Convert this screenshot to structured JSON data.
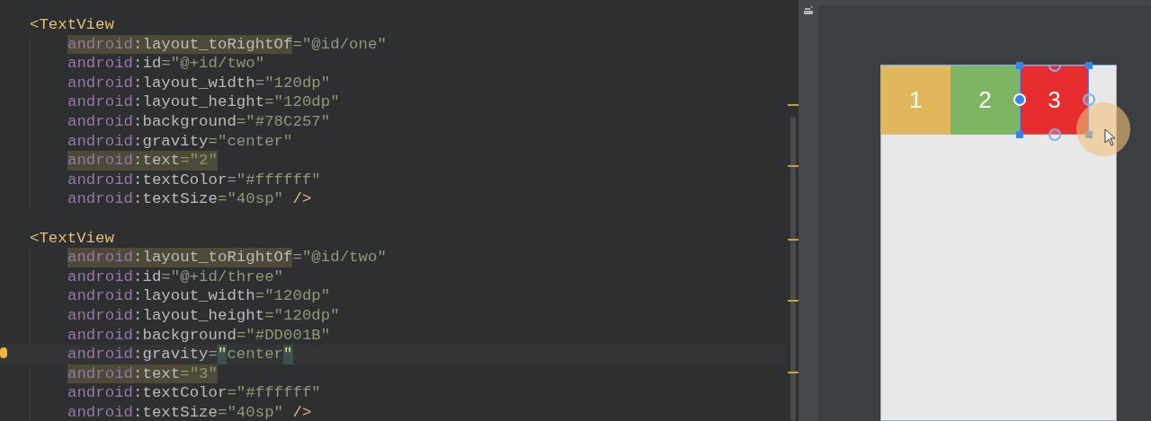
{
  "editor": {
    "lines": [
      {
        "kind": "tag",
        "current": false,
        "segments": [
          {
            "kind": "plain",
            "tokens": [
              {
                "kind": "tag",
                "text": "<TextView"
              }
            ]
          }
        ]
      },
      {
        "kind": "attribute",
        "current": false,
        "segments": [
          {
            "kind": "usage",
            "tokens": [
              {
                "kind": "ns",
                "text": "android"
              },
              {
                "kind": "attr",
                "text": ":layout_toRightOf"
              }
            ]
          },
          {
            "kind": "plain",
            "tokens": [
              {
                "kind": "value",
                "text": "=\"@id/one\""
              }
            ]
          }
        ]
      },
      {
        "kind": "attribute",
        "current": false,
        "segments": [
          {
            "kind": "plain",
            "tokens": [
              {
                "kind": "ns",
                "text": "android"
              },
              {
                "kind": "attr",
                "text": ":id"
              },
              {
                "kind": "value",
                "text": "=\"@+id/two\""
              }
            ]
          }
        ]
      },
      {
        "kind": "attribute",
        "current": false,
        "segments": [
          {
            "kind": "plain",
            "tokens": [
              {
                "kind": "ns",
                "text": "android"
              },
              {
                "kind": "attr",
                "text": ":layout_width"
              },
              {
                "kind": "value",
                "text": "=\"120dp\""
              }
            ]
          }
        ]
      },
      {
        "kind": "attribute",
        "current": false,
        "segments": [
          {
            "kind": "plain",
            "tokens": [
              {
                "kind": "ns",
                "text": "android"
              },
              {
                "kind": "attr",
                "text": ":layout_height"
              },
              {
                "kind": "value",
                "text": "=\"120dp\""
              }
            ]
          }
        ]
      },
      {
        "kind": "attribute",
        "current": false,
        "segments": [
          {
            "kind": "plain",
            "tokens": [
              {
                "kind": "ns",
                "text": "android"
              },
              {
                "kind": "attr",
                "text": ":background"
              },
              {
                "kind": "value",
                "text": "=\"#78C257\""
              }
            ]
          }
        ]
      },
      {
        "kind": "attribute",
        "current": false,
        "segments": [
          {
            "kind": "plain",
            "tokens": [
              {
                "kind": "ns",
                "text": "android"
              },
              {
                "kind": "attr",
                "text": ":gravity"
              },
              {
                "kind": "value",
                "text": "=\"center\""
              }
            ]
          }
        ]
      },
      {
        "kind": "attribute",
        "current": false,
        "segments": [
          {
            "kind": "usage",
            "tokens": [
              {
                "kind": "ns",
                "text": "android"
              },
              {
                "kind": "attr",
                "text": ":text"
              },
              {
                "kind": "value",
                "text": "=\"2\""
              }
            ]
          }
        ]
      },
      {
        "kind": "attribute",
        "current": false,
        "segments": [
          {
            "kind": "plain",
            "tokens": [
              {
                "kind": "ns",
                "text": "android"
              },
              {
                "kind": "attr",
                "text": ":textColor"
              },
              {
                "kind": "value",
                "text": "=\"#ffffff\""
              }
            ]
          }
        ]
      },
      {
        "kind": "attribute",
        "current": false,
        "segments": [
          {
            "kind": "plain",
            "tokens": [
              {
                "kind": "ns",
                "text": "android"
              },
              {
                "kind": "attr",
                "text": ":textSize"
              },
              {
                "kind": "value",
                "text": "=\"40sp\""
              },
              {
                "kind": "tag",
                "text": " />"
              }
            ]
          }
        ]
      },
      {
        "kind": "blank"
      },
      {
        "kind": "tag",
        "current": false,
        "segments": [
          {
            "kind": "plain",
            "tokens": [
              {
                "kind": "tag",
                "text": "<TextView"
              }
            ]
          }
        ]
      },
      {
        "kind": "attribute",
        "current": false,
        "segments": [
          {
            "kind": "usage",
            "tokens": [
              {
                "kind": "ns",
                "text": "android"
              },
              {
                "kind": "attr",
                "text": ":layout_toRightOf"
              }
            ]
          },
          {
            "kind": "plain",
            "tokens": [
              {
                "kind": "value",
                "text": "=\"@id/two\""
              }
            ]
          }
        ]
      },
      {
        "kind": "attribute",
        "current": false,
        "segments": [
          {
            "kind": "plain",
            "tokens": [
              {
                "kind": "ns",
                "text": "android"
              },
              {
                "kind": "attr",
                "text": ":id"
              },
              {
                "kind": "value",
                "text": "=\"@+id/three\""
              }
            ]
          }
        ]
      },
      {
        "kind": "attribute",
        "current": false,
        "segments": [
          {
            "kind": "plain",
            "tokens": [
              {
                "kind": "ns",
                "text": "android"
              },
              {
                "kind": "attr",
                "text": ":layout_width"
              },
              {
                "kind": "value",
                "text": "=\"120dp\""
              }
            ]
          }
        ]
      },
      {
        "kind": "attribute",
        "current": false,
        "segments": [
          {
            "kind": "plain",
            "tokens": [
              {
                "kind": "ns",
                "text": "android"
              },
              {
                "kind": "attr",
                "text": ":layout_height"
              },
              {
                "kind": "value",
                "text": "=\"120dp\""
              }
            ]
          }
        ]
      },
      {
        "kind": "attribute",
        "current": false,
        "segments": [
          {
            "kind": "plain",
            "tokens": [
              {
                "kind": "ns",
                "text": "android"
              },
              {
                "kind": "attr",
                "text": ":background"
              },
              {
                "kind": "value",
                "text": "=\"#DD001B\""
              }
            ]
          }
        ]
      },
      {
        "kind": "attribute",
        "current": true,
        "segments": [
          {
            "kind": "plain",
            "tokens": [
              {
                "kind": "ns",
                "text": "android"
              },
              {
                "kind": "attr",
                "text": ":gravity"
              },
              {
                "kind": "value",
                "text": "="
              }
            ]
          },
          {
            "kind": "brace",
            "tokens": [
              {
                "kind": "brace",
                "text": "\""
              }
            ]
          },
          {
            "kind": "plain",
            "tokens": [
              {
                "kind": "value",
                "text": "center"
              }
            ]
          },
          {
            "kind": "brace",
            "tokens": [
              {
                "kind": "brace",
                "text": "\""
              }
            ]
          }
        ]
      },
      {
        "kind": "attribute",
        "current": false,
        "segments": [
          {
            "kind": "usage",
            "tokens": [
              {
                "kind": "ns",
                "text": "android"
              },
              {
                "kind": "attr",
                "text": ":text"
              },
              {
                "kind": "value",
                "text": "=\"3\""
              }
            ]
          }
        ]
      },
      {
        "kind": "attribute",
        "current": false,
        "segments": [
          {
            "kind": "plain",
            "tokens": [
              {
                "kind": "ns",
                "text": "android"
              },
              {
                "kind": "attr",
                "text": ":textColor"
              },
              {
                "kind": "value",
                "text": "=\"#ffffff\""
              }
            ]
          }
        ]
      },
      {
        "kind": "attribute",
        "current": false,
        "segments": [
          {
            "kind": "plain",
            "tokens": [
              {
                "kind": "ns",
                "text": "android"
              },
              {
                "kind": "attr",
                "text": ":textSize"
              },
              {
                "kind": "value",
                "text": "=\"40sp\""
              },
              {
                "kind": "tag",
                "text": " />"
              }
            ]
          }
        ]
      }
    ]
  },
  "preview": {
    "views": [
      {
        "text": "1",
        "color": "#e0b75a",
        "selected": false
      },
      {
        "text": "2",
        "color": "#7db663",
        "selected": false
      },
      {
        "text": "3",
        "color": "#e62c2f",
        "selected": true
      }
    ]
  }
}
